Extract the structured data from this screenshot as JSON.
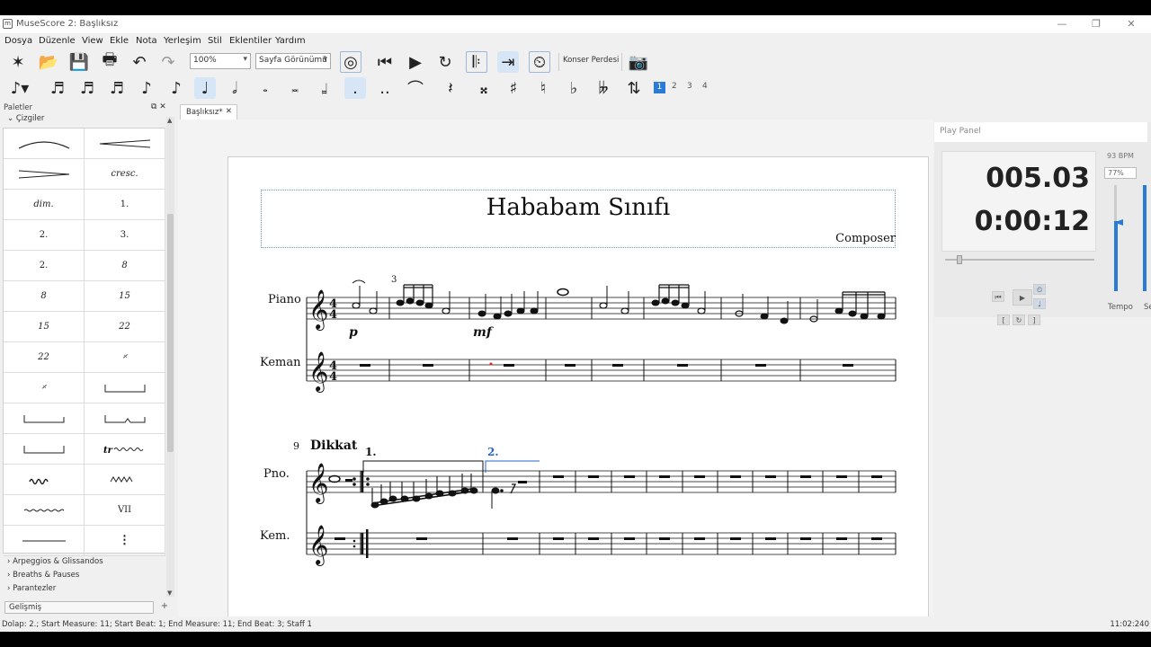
{
  "window": {
    "title": "MuseScore 2: Başlıksız"
  },
  "menu": [
    "Dosya",
    "Düzenle",
    "View",
    "Ekle",
    "Nota",
    "Yerleşim",
    "Stil",
    "Eklentiler",
    "Yardım"
  ],
  "toolbar": {
    "zoom": "100%",
    "view_mode": "Sayfa Görünümü",
    "concert_pitch": "Konser Perdesi"
  },
  "note_input": {
    "voices": [
      "1",
      "2",
      "3",
      "4"
    ],
    "active_voice": "1"
  },
  "palettes": {
    "header": "Paletler",
    "category": "Çizgiler",
    "cells": [
      "",
      "",
      "",
      "cresc.",
      "dim.",
      "1.",
      "2.",
      "3.",
      "2.",
      "8",
      "8",
      "15",
      "15",
      "22",
      "22",
      "𝄎",
      "𝄎",
      "",
      "",
      "",
      "",
      "",
      "",
      "",
      "",
      "VII",
      "",
      ""
    ],
    "other_categories": [
      "Arpeggios & Glissandos",
      "Breaths & Pauses",
      "Parantezler"
    ],
    "mode": "Gelişmiş"
  },
  "tab": {
    "label": "Başlıksız*"
  },
  "score": {
    "title": "Hababam Sınıfı",
    "composer": "Composer",
    "system1": {
      "instruments": [
        "Piano",
        "Keman"
      ],
      "dynamics": [
        "p",
        "mf"
      ],
      "tuplet": "3"
    },
    "system2": {
      "measure_number": "9",
      "rehearsal": "Dikkat",
      "instruments": [
        "Pno.",
        "Kem."
      ],
      "voltas": [
        "1.",
        "2."
      ]
    }
  },
  "play_panel": {
    "title": "Play Panel",
    "measure_beat": "005.03",
    "time": "0:00:12",
    "bpm": "93 BPM",
    "tempo_percent": "77%",
    "tempo_label": "Tempo",
    "volume_label": "Se"
  },
  "status": {
    "selection": "Dolap: 2.; Start Measure: 11; Start Beat: 1; End Measure: 11; End Beat: 3; Staff 1",
    "position": "11:02:240"
  }
}
